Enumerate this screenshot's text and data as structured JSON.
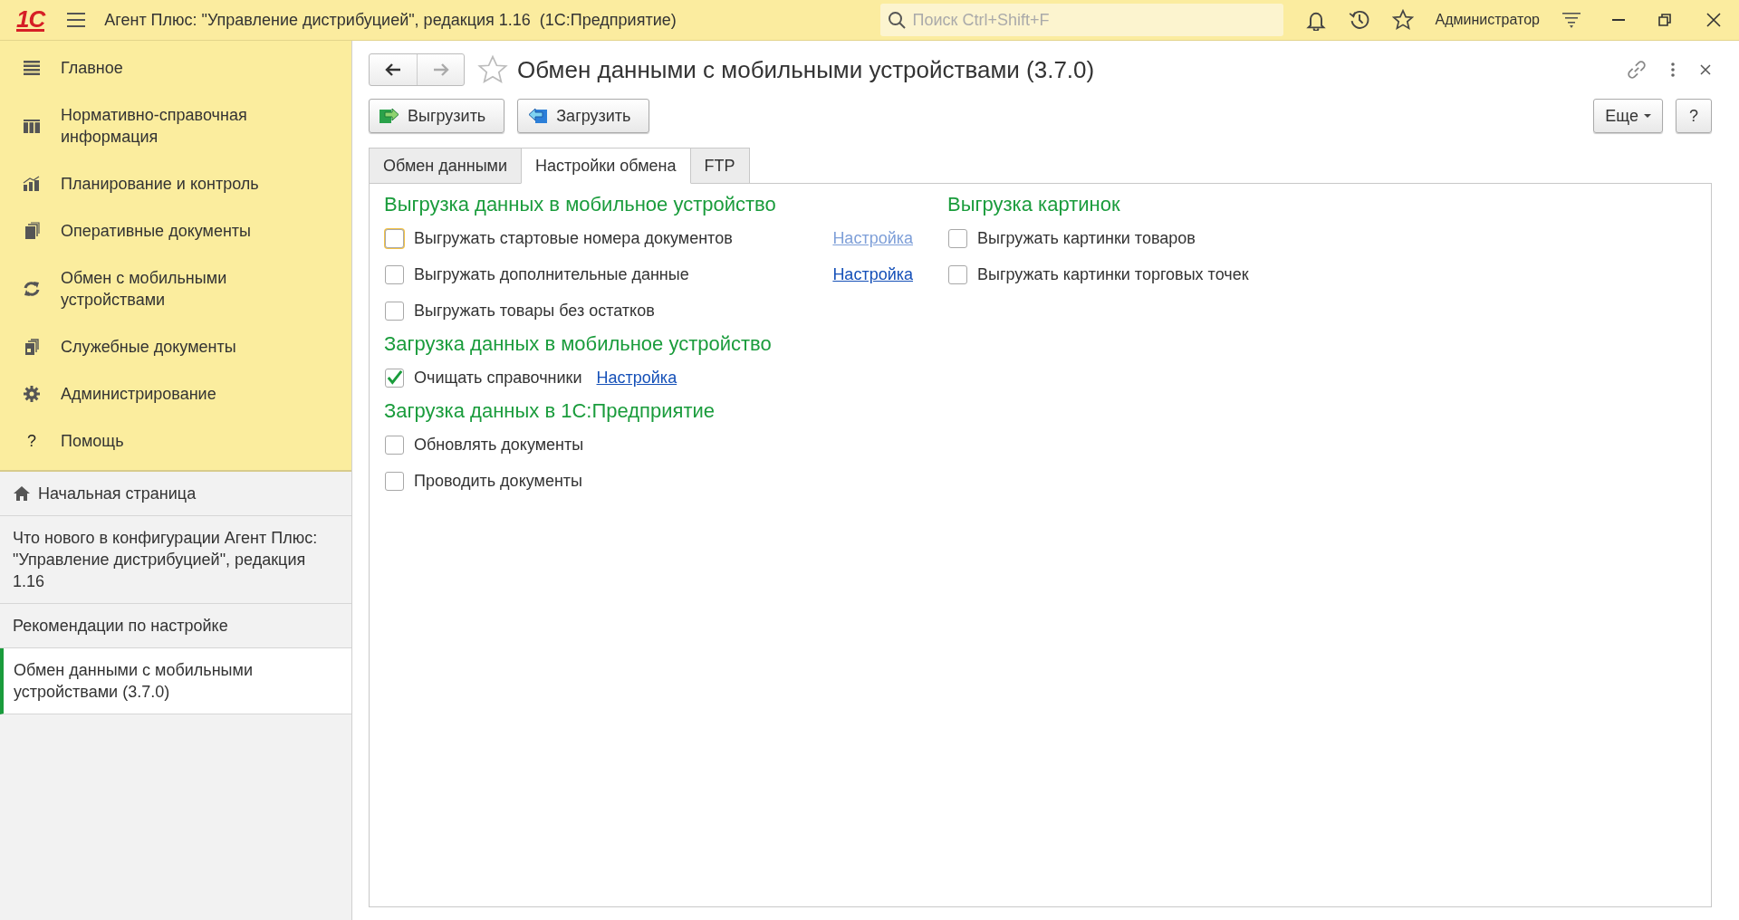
{
  "window": {
    "logo": "1С",
    "title": "Агент Плюс: \"Управление дистрибуцией\", редакция 1.16  (1С:Предприятие)",
    "search_placeholder": "Поиск Ctrl+Shift+F",
    "user": "Администратор"
  },
  "sidebar": {
    "sections": [
      {
        "label": "Главное",
        "kind": "list"
      },
      {
        "label": "Нормативно-справочная информация",
        "kind": "catalog"
      },
      {
        "label": "Планирование и контроль",
        "kind": "chart"
      },
      {
        "label": "Оперативные документы",
        "kind": "docs"
      },
      {
        "label": "Обмен с мобильными устройствами",
        "kind": "sync"
      },
      {
        "label": "Служебные документы",
        "kind": "service"
      },
      {
        "label": "Администрирование",
        "kind": "gear"
      },
      {
        "label": "Помощь",
        "kind": "help",
        "glyph": "?"
      }
    ],
    "open_windows": [
      {
        "label": "Начальная страница",
        "kind": "home",
        "selected": false
      },
      {
        "label": "Что нового в конфигурации Агент Плюс: \"Управление дистрибуцией\", редакция 1.16",
        "kind": "plain",
        "selected": false
      },
      {
        "label": "Рекомендации по настройке",
        "kind": "plain",
        "selected": false
      },
      {
        "label": "Обмен данными с мобильными устройствами (3.7.0)",
        "kind": "plain",
        "selected": true
      }
    ]
  },
  "form": {
    "nav": [
      {
        "kind": "back",
        "disabled": false
      },
      {
        "kind": "forward",
        "disabled": true
      }
    ],
    "favorite": false,
    "title": "Обмен данными с мобильными устройствами (3.7.0)",
    "buttons": [
      {
        "label": "Выгрузить",
        "kind": "upload"
      },
      {
        "label": "Загрузить",
        "kind": "download"
      }
    ],
    "more": "Еще",
    "help": "?",
    "tabs": [
      {
        "label": "Обмен данными",
        "selected": false
      },
      {
        "label": "Настройки обмена",
        "selected": true
      },
      {
        "label": "FTP",
        "selected": false
      }
    ],
    "columns": [
      {
        "sections": [
          {
            "title": "Выгрузка данных в мобильное устройство",
            "kind": "grid",
            "rows": [
              {
                "label": "Выгружать стартовые номера документов",
                "checked": false,
                "focused": true,
                "link": {
                  "label": "Настройка",
                  "disabled": true
                }
              },
              {
                "label": "Выгружать дополнительные данные",
                "checked": false,
                "focused": false,
                "link": {
                  "label": "Настройка",
                  "disabled": false
                }
              },
              {
                "label": "Выгружать товары без остатков",
                "checked": false,
                "focused": false
              }
            ]
          },
          {
            "title": "Загрузка данных в мобильное устройство",
            "kind": "inline",
            "rows": [
              {
                "label": "Очищать справочники",
                "checked": true,
                "focused": false,
                "link": {
                  "label": "Настройка",
                  "disabled": false
                }
              }
            ]
          },
          {
            "title": "Загрузка данных в 1С:Предприятие",
            "kind": "inline",
            "rows": [
              {
                "label": "Обновлять документы",
                "checked": false,
                "focused": false
              },
              {
                "label": "Проводить документы",
                "checked": false,
                "focused": false
              }
            ]
          }
        ]
      },
      {
        "sections": [
          {
            "title": "Выгрузка картинок",
            "kind": "inline",
            "rows": [
              {
                "label": "Выгружать картинки товаров",
                "checked": false,
                "focused": false
              },
              {
                "label": "Выгружать картинки торговых точек",
                "checked": false,
                "focused": false
              }
            ]
          }
        ]
      }
    ]
  }
}
